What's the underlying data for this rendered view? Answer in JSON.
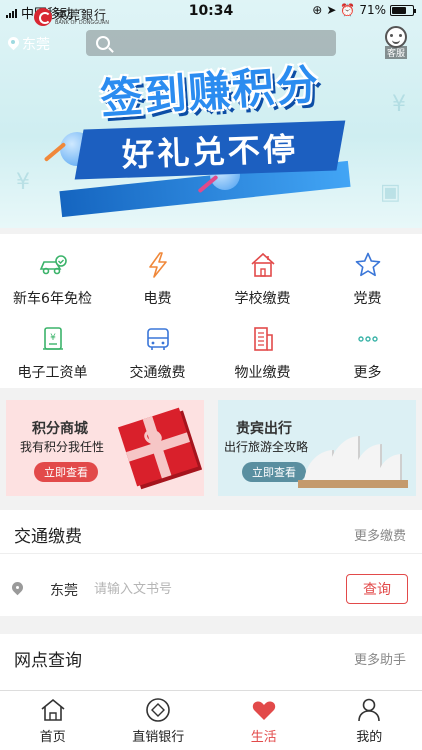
{
  "status_bar": {
    "carrier": "中国移动",
    "time": "10:34",
    "battery": "71%",
    "battery_level": 0.71
  },
  "header": {
    "bank_name_cn": "東莞銀行",
    "bank_name_en": "BANK OF DONGGUAN",
    "location": "东莞",
    "search_placeholder": "",
    "customer_service_label": "客服"
  },
  "banner": {
    "headline": "签到赚积分",
    "subheadline": "好礼兑不停"
  },
  "services": [
    {
      "label": "新车6年免检",
      "icon": "car-check-icon",
      "color": "#3bb36a"
    },
    {
      "label": "电费",
      "icon": "lightning-icon",
      "color": "#f0883a"
    },
    {
      "label": "学校缴费",
      "icon": "school-house-icon",
      "color": "#e24a4a"
    },
    {
      "label": "党费",
      "icon": "star-icon",
      "color": "#3a76d8"
    },
    {
      "label": "电子工资单",
      "icon": "salary-scroll-icon",
      "color": "#3bb36a"
    },
    {
      "label": "交通缴费",
      "icon": "bus-icon",
      "color": "#3a76d8"
    },
    {
      "label": "物业缴费",
      "icon": "building-icon",
      "color": "#e24a4a"
    },
    {
      "label": "更多",
      "icon": "more-dots-icon",
      "color": "#3bb3a8"
    }
  ],
  "promos": [
    {
      "title": "积分商城",
      "subtitle": "我有积分我任性",
      "button": "立即查看"
    },
    {
      "title": "贵宾出行",
      "subtitle": "出行旅游全攻略",
      "button": "立即查看"
    }
  ],
  "traffic": {
    "title": "交通缴费",
    "more": "更多缴费",
    "city": "东莞",
    "input_placeholder": "请输入文书号",
    "query_button": "查询"
  },
  "branch": {
    "title": "网点查询",
    "more": "更多助手"
  },
  "tabs": [
    {
      "label": "首页",
      "icon": "home-icon",
      "active": false
    },
    {
      "label": "直销银行",
      "icon": "direct-bank-icon",
      "active": false
    },
    {
      "label": "生活",
      "icon": "heart-icon",
      "active": true
    },
    {
      "label": "我的",
      "icon": "person-icon",
      "active": false
    }
  ],
  "colors": {
    "accent": "#e24a4a",
    "banner_blue": "#2b8cf0"
  }
}
